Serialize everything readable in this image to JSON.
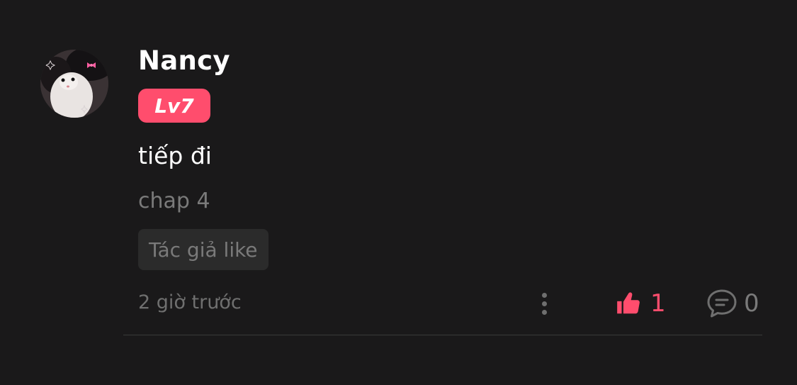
{
  "comment": {
    "user": {
      "name": "Nancy",
      "level": "Lv7",
      "avatar_icon": "cat-avatar"
    },
    "text": "tiếp đi",
    "chapter": "chap 4",
    "author_like_label": "Tác giả like",
    "timestamp": "2 giờ trước",
    "likes": "1",
    "replies": "0"
  },
  "colors": {
    "background": "#1a191a",
    "accent": "#ff4d6d",
    "muted_text": "#7a7a7a",
    "chip_background": "#2b2b2b"
  },
  "icons": {
    "more": "more-vertical-icon",
    "like": "thumbs-up-icon",
    "reply": "comment-bubble-icon"
  }
}
